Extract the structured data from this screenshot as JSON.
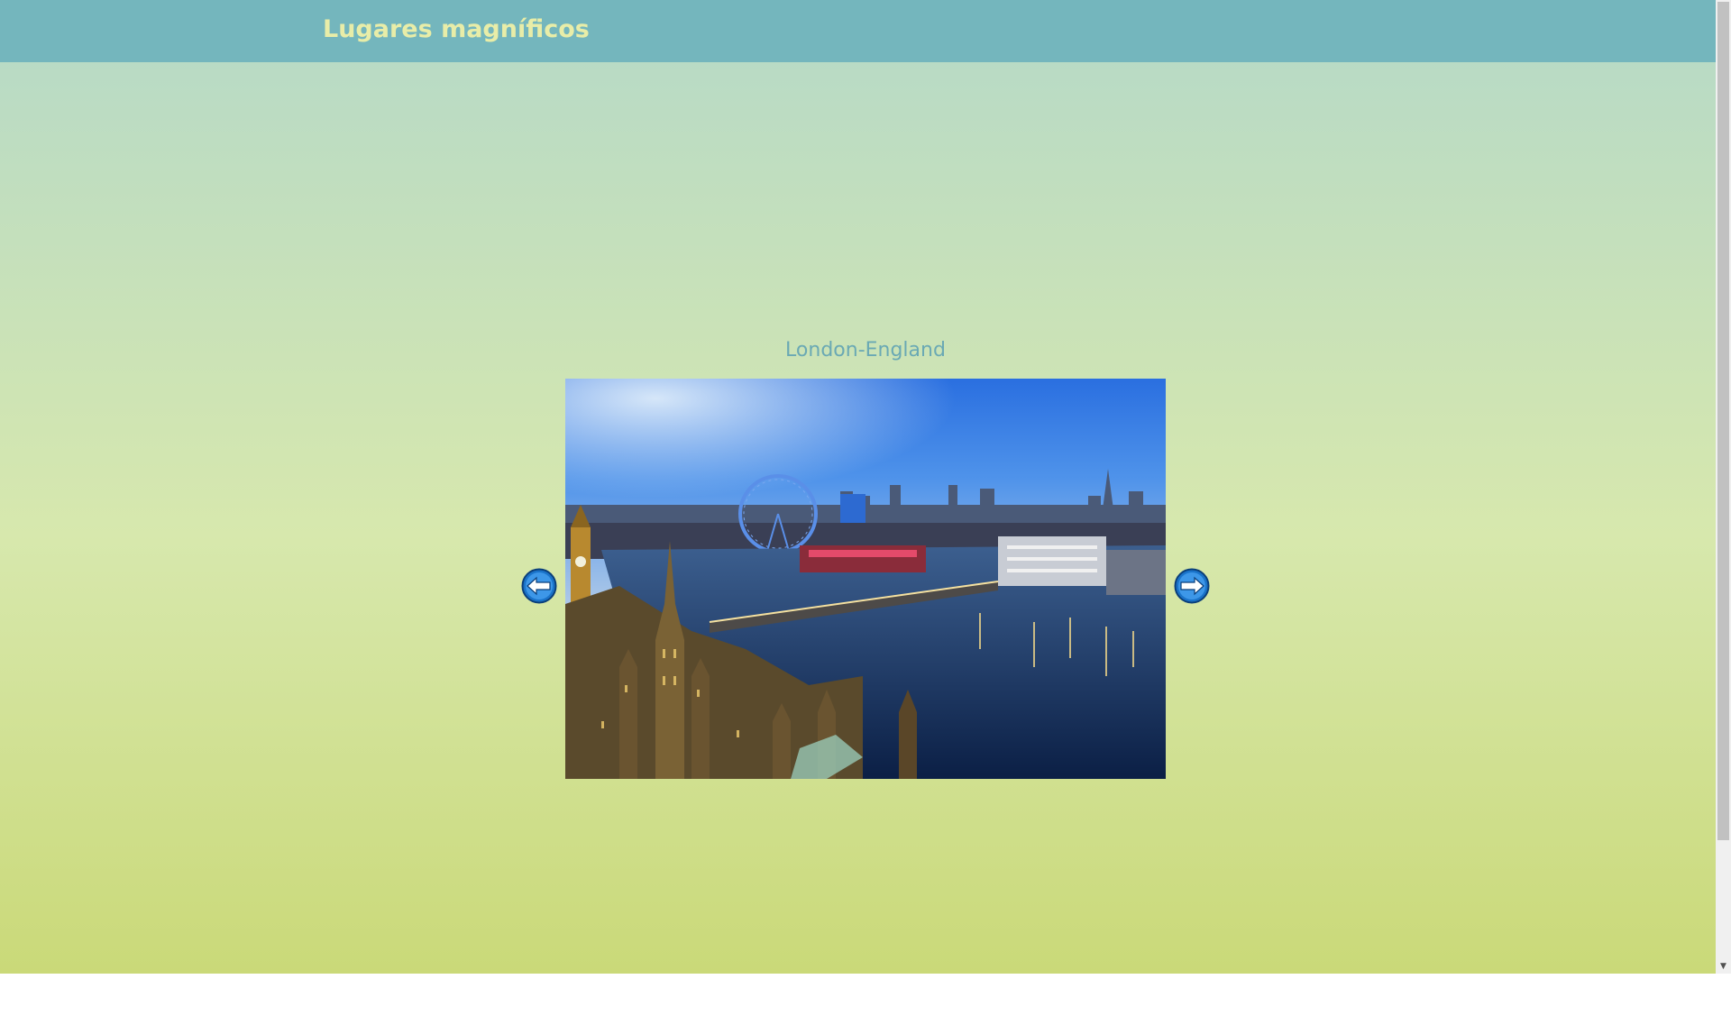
{
  "header": {
    "title": "Lugares magníficos"
  },
  "slideshow": {
    "caption": "London-England",
    "image_subject": "London skyline at dusk with Thames river, London Eye, Big Ben and Westminster",
    "prev_icon": "arrow-left-circle-icon",
    "next_icon": "arrow-right-circle-icon"
  },
  "colors": {
    "header_bg": "#74b6bd",
    "title_text": "#e8eda8",
    "caption_text": "#6aa9b4",
    "gradient_top": "#b5d9c8",
    "gradient_bottom": "#cad978",
    "arrow_fill": "#1a73c9"
  },
  "scrollbar": {
    "up_glyph": "▲",
    "down_glyph": "▼"
  }
}
